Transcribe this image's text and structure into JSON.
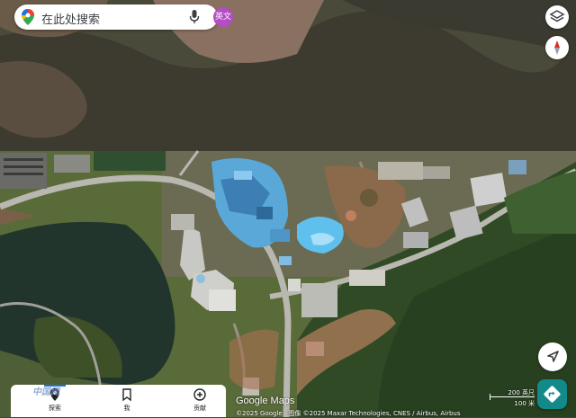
{
  "search": {
    "placeholder": "在此处搜索",
    "avatar_label": "英文"
  },
  "controls": {
    "layers_icon": "layers-icon",
    "compass_icon": "compass-icon",
    "locate_icon": "navigation-arrow-icon",
    "directions_icon": "directions-icon"
  },
  "bottom_nav": {
    "items": [
      {
        "label": "探索",
        "icon": "explore-pin-icon",
        "active": true
      },
      {
        "label": "我",
        "icon": "bookmark-icon"
      },
      {
        "label": "贡献",
        "icon": "add-circle-icon"
      }
    ],
    "overlay_watermark": "中国网"
  },
  "map": {
    "brand": "Google Maps",
    "attribution": "©2025 Google · 图像 ©2025 Maxar Technologies, CNES / Airbus, Airbus",
    "scale": {
      "imperial": "200 英尺",
      "metric": "100 米"
    }
  },
  "colors": {
    "accent": "#1a73e8",
    "avatar": "#b44cc4",
    "directions": "#128a8a",
    "compass_needle": "#d93025"
  }
}
